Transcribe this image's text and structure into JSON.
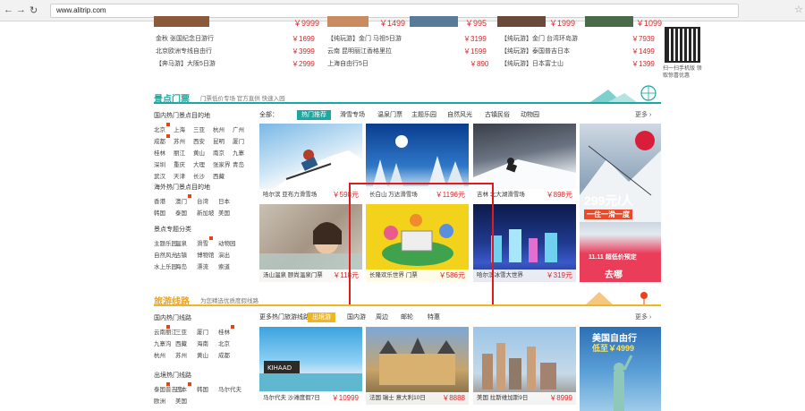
{
  "browser": {
    "back": "←",
    "forward": "→",
    "reload": "↻",
    "url": "www.alitrip.com"
  },
  "top_strip": {
    "prices": [
      "￥9999",
      "￥1499",
      "￥995",
      "￥1999",
      "￥1099"
    ]
  },
  "mini_lists": [
    {
      "rows": [
        {
          "name": "金秋 张国纪念日游行",
          "price": "￥1699"
        },
        {
          "name": "北京欧洲专线自由行",
          "price": "￥3999"
        },
        {
          "name": "【奔马游】大阪5日游",
          "price": "￥2999"
        }
      ]
    },
    {
      "rows": [
        {
          "name": "【纯玩游】金门 马祖5日游",
          "price": "￥3199"
        },
        {
          "name": "云南 昆明丽江香格里拉",
          "price": "￥1599"
        },
        {
          "name": "上海自由行5日",
          "price": "￥890"
        }
      ]
    },
    {
      "rows": [
        {
          "name": "【纯玩游】金门 台湾环岛游",
          "price": "￥7939"
        },
        {
          "name": "【纯玩游】泰国普吉日本",
          "price": "￥1499"
        },
        {
          "name": "【纯玩游】日本富士山",
          "price": "￥1399"
        }
      ]
    }
  ],
  "qr": {
    "caption": "扫一扫手机版 领取惊喜优惠"
  },
  "section1": {
    "title": "景点门票",
    "subtitle": "门票低价专场 官方直供 快速入园",
    "tabs": [
      {
        "label": "热门推荐"
      },
      {
        "label": "滑雪专场"
      },
      {
        "label": "温泉门票"
      },
      {
        "label": "主题乐园"
      },
      {
        "label": "自然风光"
      },
      {
        "label": "古镇民俗"
      },
      {
        "label": "动物园"
      }
    ],
    "more": "更多 ›",
    "lists": [
      {
        "title": "国内热门景点目的地",
        "links": [
          "北京",
          "上海",
          "三亚",
          "杭州",
          "广州",
          "成都",
          "苏州",
          "西安",
          "昆明",
          "厦门",
          "桂林",
          "丽江",
          "黄山",
          "南京",
          "九寨",
          "深圳",
          "重庆",
          "大理",
          "张家界",
          "青岛",
          "武汉",
          "天津",
          "长沙",
          "西藏"
        ]
      },
      {
        "title": "海外热门景点目的地",
        "links": [
          "香港",
          "澳门",
          "台湾",
          "日本",
          "韩国",
          "泰国",
          "新加坡",
          "美国"
        ]
      },
      {
        "title": "景点专题分类",
        "links": [
          "主题乐园",
          "温泉",
          "滑雪",
          "动物园",
          "自然风光",
          "古镇",
          "博物馆",
          "演出",
          "水上乐园",
          "海岛",
          "漂流",
          "索道"
        ]
      }
    ],
    "tiles": [
      {
        "caption": "哈尔滨 亚布力滑雪场",
        "price": "￥598元"
      },
      {
        "caption": "长白山 万达滑雪场",
        "price": "￥1196元"
      },
      {
        "caption": "吉林 北大湖滑雪场",
        "price": "￥898元"
      },
      {
        "caption": "汤山温泉 颐尚温泉门票",
        "price": "￥118元"
      },
      {
        "caption": "长隆欢乐世界 门票",
        "price": "￥586元"
      },
      {
        "caption": "哈尔滨冰雪大世界",
        "price": "￥319元"
      }
    ],
    "promo": {
      "price": "299元/人",
      "line": "一住一滑一度",
      "badge": "11.11 超低价预定",
      "brand": "去哪"
    }
  },
  "section2": {
    "title": "旅游线路",
    "subtitle": "为您精选优质度假线路",
    "tabs": [
      {
        "label": "更多热门旅游线路"
      },
      {
        "label": "出境游"
      },
      {
        "label": "国内游"
      },
      {
        "label": "周边"
      },
      {
        "label": "邮轮"
      },
      {
        "label": "特惠"
      }
    ],
    "more": "更多 ›",
    "lists": [
      {
        "title": "国内热门线路",
        "links": [
          "云南丽江",
          "三亚",
          "厦门",
          "桂林",
          "九寨沟",
          "西藏",
          "海南",
          "北京",
          "杭州",
          "苏州",
          "黄山",
          "成都"
        ]
      },
      {
        "title": "出境热门线路",
        "links": [
          "泰国普吉岛",
          "日本",
          "韩国",
          "马尔代夫",
          "欧洲",
          "美国"
        ]
      }
    ],
    "tiles": [
      {
        "caption": "马尔代夫 沙滩度假7日",
        "price": "￥10999"
      },
      {
        "caption": "法国 瑞士 意大利10日",
        "price": "￥8888"
      },
      {
        "caption": "美国 拉斯维加斯9日",
        "price": "￥8999"
      }
    ],
    "promo": {
      "title": "美国自由行",
      "price": "低至￥4999"
    }
  },
  "colors": {
    "accent": "#1aa9a2",
    "price": "#d9282b",
    "active_tab1": "#1aa9a2",
    "active_tab2": "#f0b521",
    "highlight": "#e01b1b"
  }
}
